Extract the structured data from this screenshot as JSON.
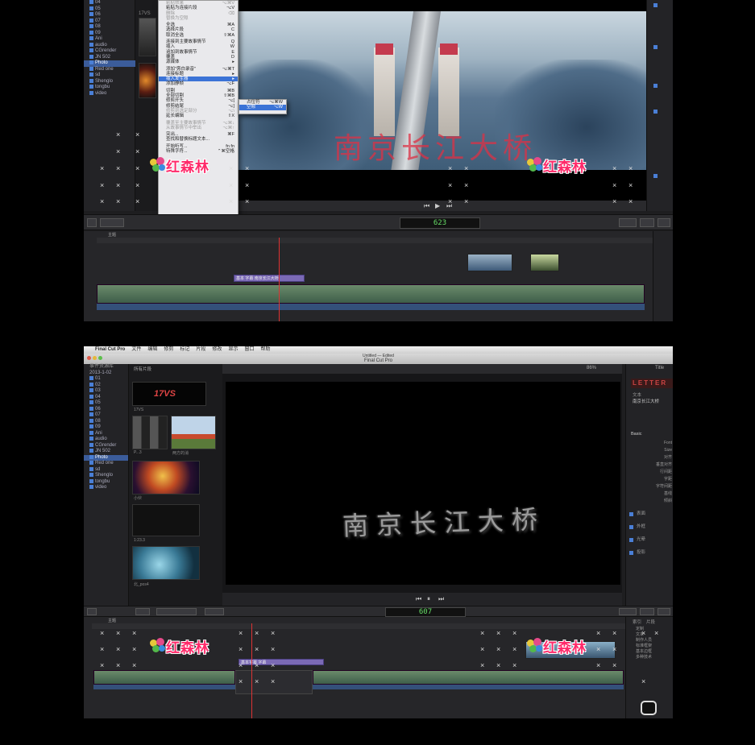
{
  "shot1": {
    "library_items": [
      "04",
      "05",
      "06",
      "07",
      "08",
      "09",
      "Ani",
      "audio",
      "CGrender",
      "JN 502",
      "Photo",
      "Red one",
      "sd",
      "Shenglo",
      "tongbu",
      "video"
    ],
    "selected_library_item": "Photo",
    "thumb_label": "17VS",
    "context_menu": {
      "items": [
        {
          "label": "粘贴效果",
          "shortcut": "⌥⌘V",
          "disabled": true
        },
        {
          "label": "粘贴为连接片段",
          "shortcut": "⌥V",
          "disabled": false
        },
        {
          "label": "删除",
          "shortcut": "⌫",
          "disabled": true
        },
        {
          "label": "替换为空隙",
          "shortcut": "",
          "disabled": true
        },
        {
          "sep": true
        },
        {
          "label": "全选",
          "shortcut": "⌘A",
          "disabled": false
        },
        {
          "label": "选择片段",
          "shortcut": "C",
          "disabled": false
        },
        {
          "label": "取消全选",
          "shortcut": "⇧⌘A",
          "disabled": false
        },
        {
          "sep": true
        },
        {
          "label": "连接到主要故事情节",
          "shortcut": "Q",
          "disabled": false
        },
        {
          "label": "插入",
          "shortcut": "W",
          "disabled": false
        },
        {
          "label": "追加到故事情节",
          "shortcut": "E",
          "disabled": false
        },
        {
          "label": "覆盖",
          "shortcut": "D",
          "disabled": false
        },
        {
          "label": "源媒体",
          "shortcut": "▸",
          "disabled": false
        },
        {
          "sep": true
        },
        {
          "label": "添加\"旁白录音\"",
          "shortcut": "⌥⌘T",
          "disabled": false
        },
        {
          "label": "连接标题",
          "shortcut": "▸",
          "disabled": false
        },
        {
          "label": "插入发生器",
          "shortcut": "▸",
          "disabled": false,
          "highlight": true
        },
        {
          "label": "添加静帧",
          "shortcut": "⌥F",
          "disabled": false
        },
        {
          "sep": true
        },
        {
          "label": "切割",
          "shortcut": "⌘B",
          "disabled": false
        },
        {
          "label": "全部切割",
          "shortcut": "⇧⌘B",
          "disabled": false
        },
        {
          "label": "修剪开头",
          "shortcut": "⌥[",
          "disabled": false
        },
        {
          "label": "修剪结尾",
          "shortcut": "⌥]",
          "disabled": false
        },
        {
          "label": "修剪到选定部分",
          "shortcut": "⌥\\",
          "disabled": true
        },
        {
          "label": "延长编辑",
          "shortcut": "⇧X",
          "disabled": false
        },
        {
          "sep": true
        },
        {
          "label": "覆盖至主要故事情节",
          "shortcut": "⌥⌘↓",
          "disabled": true
        },
        {
          "label": "从故事情节中举出",
          "shortcut": "⌥⌘↑",
          "disabled": true
        },
        {
          "sep": true
        },
        {
          "label": "突出...",
          "shortcut": "⌘F",
          "disabled": false
        },
        {
          "label": "查找和替换标题文本...",
          "shortcut": "",
          "disabled": false
        },
        {
          "sep": true
        },
        {
          "label": "开始听写...",
          "shortcut": "fn fn",
          "disabled": false
        },
        {
          "label": "特殊字符...",
          "shortcut": "⌃⌘空格",
          "disabled": false
        }
      ],
      "submenu": [
        {
          "label": "占位符",
          "shortcut": "⌥⌘W",
          "highlight": false
        },
        {
          "label": "空隙",
          "shortcut": "⌥W",
          "highlight": true
        }
      ]
    },
    "viewer_title": "南京长江大桥",
    "timecode": "623",
    "timeline_label": "主题",
    "title_clip_label": "基本 字幕 南京长江大桥",
    "watermark_text": "红森林"
  },
  "shot2": {
    "menubar": [
      "Final Cut Pro",
      "文件",
      "编辑",
      "修剪",
      "标记",
      "片段",
      "修改",
      "显示",
      "窗口",
      "帮助"
    ],
    "window_title_top": "Untitled — Edited",
    "window_title": "Final Cut Pro",
    "library_header": "事件资源库",
    "event_date": "2013-1-02",
    "library_items": [
      "01",
      "02",
      "03",
      "04",
      "05",
      "06",
      "07",
      "08",
      "09",
      "Ani",
      "audio",
      "CGrender",
      "JN 502",
      "Photo",
      "Red one",
      "sd",
      "Shenglo",
      "tongbu",
      "video"
    ],
    "selected_library_item": "Photo",
    "browser_header": "所有片段",
    "thumb_labels": [
      "17VS",
      "P...3",
      "两方的消",
      "小伙",
      "1:23.3",
      "北_pos4"
    ],
    "thumb_logo": "17VS",
    "viewer_title": "南京长江大桥",
    "viewer_zoom": "86%",
    "inspector_tab": "Title",
    "inspector_title_text": "LETTER",
    "inspector_section": "文本",
    "inspector_text_value": "南京长江大桥",
    "inspector_basic": "Basic",
    "inspector_labels": [
      "Font",
      "Size",
      "对齐",
      "垂直对齐",
      "行间距",
      "字距",
      "字符间距",
      "基线",
      "倾斜"
    ],
    "inspector_groups": [
      "表面",
      "外框",
      "光晕",
      "投影"
    ],
    "timecode": "607",
    "timeline_label": "主题",
    "title_clip_label": "基本字幕 字幕",
    "watermark_text": "红森林",
    "index_tabs": [
      "索引",
      "片段"
    ],
    "index_items": [
      "定制",
      "文本",
      "制作人员",
      "标准框架",
      "基本边框",
      "多种技术"
    ]
  }
}
